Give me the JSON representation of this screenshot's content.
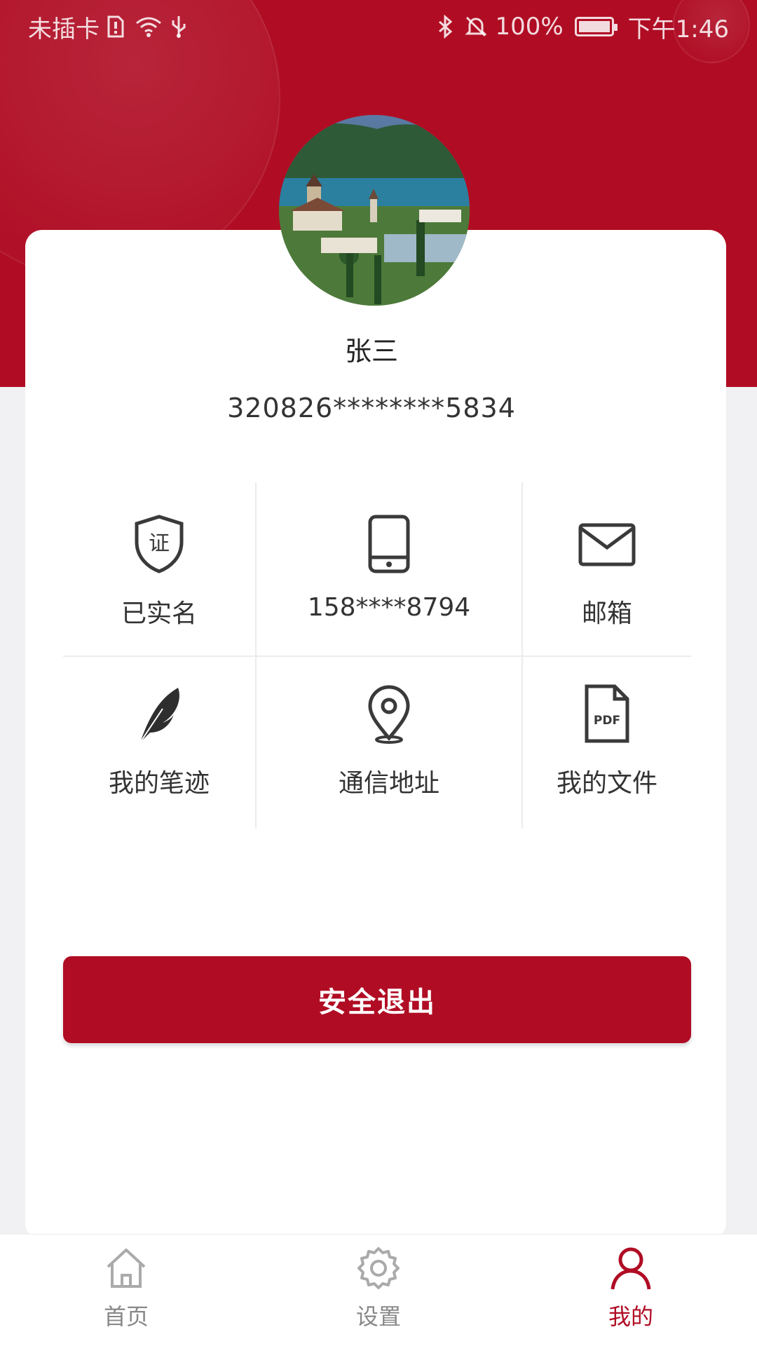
{
  "status_bar": {
    "carrier": "未插卡",
    "battery": "100%",
    "time": "下午1:46"
  },
  "profile": {
    "name": "张三",
    "id_number": "320826********5834"
  },
  "grid": {
    "items": [
      {
        "label": "已实名",
        "icon": "certificate-shield-icon",
        "icon_text": "证"
      },
      {
        "label": "158****8794",
        "icon": "mobile-phone-icon"
      },
      {
        "label": "邮箱",
        "icon": "envelope-icon"
      },
      {
        "label": "我的笔迹",
        "icon": "feather-icon"
      },
      {
        "label": "通信地址",
        "icon": "location-pin-icon"
      },
      {
        "label": "我的文件",
        "icon": "pdf-file-icon",
        "icon_text": "PDF"
      }
    ]
  },
  "logout_label": "安全退出",
  "tabs": [
    {
      "label": "首页",
      "icon": "home-icon",
      "active": false
    },
    {
      "label": "设置",
      "icon": "gear-icon",
      "active": false
    },
    {
      "label": "我的",
      "icon": "user-icon",
      "active": true
    }
  ],
  "colors": {
    "brand": "#b00d24",
    "background": "#f1f1f3",
    "card": "#ffffff"
  }
}
